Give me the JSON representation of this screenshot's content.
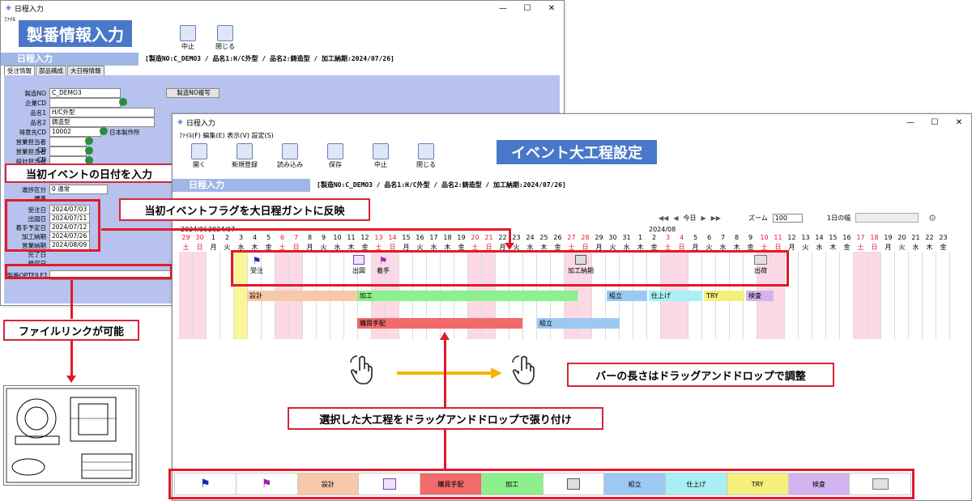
{
  "back_window": {
    "title": "日程入力",
    "menu": "ﾌｧｲﾙ",
    "banner": "製番情報入力",
    "toolbar": [
      {
        "label": "中止"
      },
      {
        "label": "閉じる"
      }
    ],
    "section": "日程入力",
    "info": "[製造NO:C_DEMO3 / 品名1:H/C外型 / 品名2:鋳造型 / 加工納期:2024/07/26]",
    "tabs": [
      "受注情報",
      "部品構成",
      "大日程情報"
    ],
    "fields": [
      {
        "label": "製造NO",
        "value": "C_DEMO3"
      },
      {
        "label": "企業CD",
        "value": ""
      },
      {
        "label": "品名1",
        "value": "H/C外型"
      },
      {
        "label": "品名2",
        "value": "鋳造型"
      },
      {
        "label": "得意先CD",
        "value": "10002"
      },
      {
        "label": "営業担当者CD",
        "value": ""
      },
      {
        "label": "営業担当者CD",
        "value": ""
      },
      {
        "label": "設計担当者CD",
        "value": ""
      }
    ],
    "customer_name": "日本製作所",
    "copy_button": "製造NO複写",
    "misc_labels": [
      "進捗区分",
      "標準",
      "進捗率"
    ],
    "misc_values": [
      "0",
      "通常"
    ],
    "dates": [
      {
        "label": "受注日",
        "value": "2024/07/03"
      },
      {
        "label": "出図日",
        "value": "2024/07/11"
      },
      {
        "label": "着手予定日",
        "value": "2024/07/12"
      },
      {
        "label": "加工納期",
        "value": "2024/07/26"
      },
      {
        "label": "営業納期",
        "value": "2024/08/09"
      },
      {
        "label": "完了日",
        "value": ""
      },
      {
        "label": "検収日",
        "value": ""
      }
    ],
    "file_label": "製番OPTFILE1"
  },
  "front_window": {
    "title": "日程入力",
    "menu": "ﾌｧｲﾙ(F)  編集(E)  表示(V)  設定(S)",
    "toolbar": [
      {
        "label": "開く"
      },
      {
        "label": "新規登録"
      },
      {
        "label": "読み込み"
      },
      {
        "label": "保存"
      },
      {
        "label": "中止"
      },
      {
        "label": "閉じる"
      }
    ],
    "banner": "イベント大工程設定",
    "section": "日程入力",
    "info": "[製造NO:C_DEMO3 / 品名1:H/C外型 / 品名2:鋳造型 / 加工納期:2024/07/26]",
    "nav": {
      "today": "今日",
      "zoom_label": "ズーム",
      "zoom_value": "100",
      "day_width_label": "1日の幅"
    },
    "months": [
      "2024/06",
      "2024/07",
      "2024/08"
    ],
    "days": [
      "29",
      "30",
      "1",
      "2",
      "3",
      "4",
      "5",
      "6",
      "7",
      "8",
      "9",
      "10",
      "11",
      "12",
      "13",
      "14",
      "15",
      "16",
      "17",
      "18",
      "19",
      "20",
      "21",
      "22",
      "23",
      "24",
      "25",
      "26",
      "27",
      "28",
      "29",
      "30",
      "31",
      "1",
      "2",
      "3",
      "4",
      "5",
      "6",
      "7",
      "8",
      "9",
      "10",
      "11",
      "12",
      "13",
      "14",
      "15",
      "16",
      "17",
      "18",
      "19",
      "20",
      "21",
      "22",
      "23"
    ],
    "weekdays": [
      "土",
      "日",
      "月",
      "火",
      "水",
      "木",
      "金",
      "土",
      "日",
      "月",
      "火",
      "水",
      "木",
      "金",
      "土",
      "日",
      "月",
      "火",
      "水",
      "木",
      "金",
      "土",
      "日",
      "月",
      "火",
      "水",
      "木",
      "金",
      "土",
      "日",
      "月",
      "火",
      "水",
      "木",
      "金",
      "土",
      "日",
      "月",
      "火",
      "水",
      "木",
      "金",
      "土",
      "日",
      "月",
      "火",
      "水",
      "木",
      "金",
      "土",
      "日",
      "月",
      "火",
      "水",
      "木",
      "金"
    ],
    "events": [
      {
        "label": "受注",
        "icon": "blue-flag-icon"
      },
      {
        "label": "出図",
        "icon": "drawing-icon"
      },
      {
        "label": "着手",
        "icon": "purple-flag-icon"
      },
      {
        "label": "加工納期",
        "icon": "machine-icon"
      },
      {
        "label": "出荷",
        "icon": "truck-icon"
      }
    ],
    "bars": [
      {
        "label": "設計",
        "color": "#f8c8a8"
      },
      {
        "label": "加工",
        "color": "#8cf08c"
      },
      {
        "label": "組立",
        "color": "#9cc8f4"
      },
      {
        "label": "仕上げ",
        "color": "#a8f0f4"
      },
      {
        "label": "TRY",
        "color": "#f4f07c"
      },
      {
        "label": "検査",
        "color": "#d4b4f0"
      },
      {
        "label": "購買手配",
        "color": "#f26a6a"
      },
      {
        "label": "組立",
        "color": "#9cc8f4"
      }
    ],
    "palette": [
      {
        "label": "",
        "color": "#ffffff",
        "icon": "blue-flag-icon"
      },
      {
        "label": "",
        "color": "#ffffff",
        "icon": "purple-flag-icon"
      },
      {
        "label": "設計",
        "color": "#f8c8a8"
      },
      {
        "label": "",
        "color": "#ffffff",
        "icon": "drawing-icon"
      },
      {
        "label": "購買手配",
        "color": "#f26a6a"
      },
      {
        "label": "加工",
        "color": "#8cf08c"
      },
      {
        "label": "",
        "color": "#ffffff",
        "icon": "machine-icon"
      },
      {
        "label": "組立",
        "color": "#9cc8f4"
      },
      {
        "label": "仕上げ",
        "color": "#a8f0f4"
      },
      {
        "label": "TRY",
        "color": "#f4f07c"
      },
      {
        "label": "検査",
        "color": "#d4b4f0"
      },
      {
        "label": "",
        "color": "#ffffff",
        "icon": "truck-icon"
      }
    ]
  },
  "callouts": {
    "enter_dates": "当初イベントの日付を入力",
    "reflect_flags": "当初イベントフラグを大日程ガントに反映",
    "file_link": "ファイルリンクが可能",
    "drag_length": "バーの長さはドラッグアンドドロップで調整",
    "drag_paste": "選択した大工程をドラッグアンドドロップで張り付け"
  },
  "colors": {
    "accent": "#4a78c8",
    "highlight_red": "#e11a2b",
    "arrow_orange": "#f5b400",
    "weekend_pink": "#fbd9e5",
    "today_yellow": "#fbf59a"
  }
}
